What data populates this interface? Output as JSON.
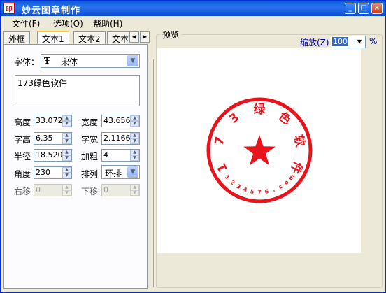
{
  "window": {
    "title": "妙云图章制作",
    "icon": "seal-app-icon"
  },
  "menu": [
    {
      "label": "文件(F)"
    },
    {
      "label": "选项(O)"
    },
    {
      "label": "帮助(H)"
    }
  ],
  "tabs": [
    {
      "label": "外框"
    },
    {
      "label": "文本1",
      "active": true
    },
    {
      "label": "文本2"
    },
    {
      "label": "文本"
    }
  ],
  "form": {
    "font_label": "字体：",
    "font_value": "宋体",
    "text_value": "173绿色软件",
    "height_label": "高度",
    "height_value": "33.072",
    "width_label": "宽度",
    "width_value": "43.656",
    "char_height_label": "字高",
    "char_height_value": "6.35",
    "char_width_label": "字宽",
    "char_width_value": "2.1166",
    "radius_label": "半径",
    "radius_value": "18.520",
    "bold_label": "加粗",
    "bold_value": "4",
    "angle_label": "角度",
    "angle_value": "230",
    "arrange_label": "排列",
    "arrange_value": "环排",
    "right_shift_label": "右移",
    "right_shift_value": "0",
    "down_shift_label": "下移",
    "down_shift_value": "0"
  },
  "preview": {
    "title": "预览",
    "zoom_label": "缩放(Z)",
    "zoom_value": "100",
    "percent": "%"
  },
  "seal": {
    "color": "#e8141c",
    "outer_chars": [
      "1",
      "7",
      "3",
      "绿",
      "色",
      "软",
      "件"
    ],
    "inner_text": "1234576.com"
  }
}
